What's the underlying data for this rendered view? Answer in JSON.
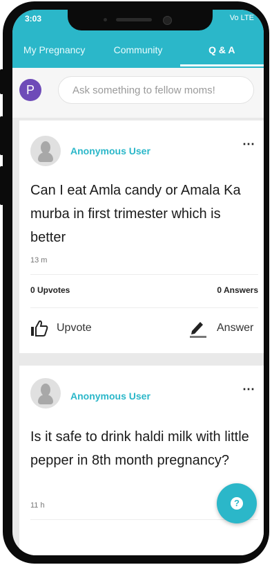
{
  "status_bar": {
    "time": "3:03",
    "icons_right": "Vo LTE"
  },
  "tabs": [
    {
      "label": "My Pregnancy",
      "active": false
    },
    {
      "label": "Community",
      "active": false
    },
    {
      "label": "Q & A",
      "active": true
    }
  ],
  "ask": {
    "avatar_letter": "P",
    "placeholder": "Ask something to fellow moms!"
  },
  "posts": [
    {
      "user": "Anonymous User",
      "question": "Can I eat Amla candy or Amala Ka murba  in first trimester which is better",
      "time": "13 m",
      "upvotes": "0 Upvotes",
      "answers": "0 Answers",
      "upvote_label": "Upvote",
      "answer_label": "Answer"
    },
    {
      "user": "Anonymous User",
      "question": "Is it safe to drink haldi milk with little pepper in 8th month pregnancy?",
      "time": "11 h"
    }
  ],
  "more_icon": "⋯",
  "fab": {
    "icon": "?"
  },
  "colors": {
    "accent": "#2bb7c9",
    "avatar": "#6e4bb8"
  }
}
